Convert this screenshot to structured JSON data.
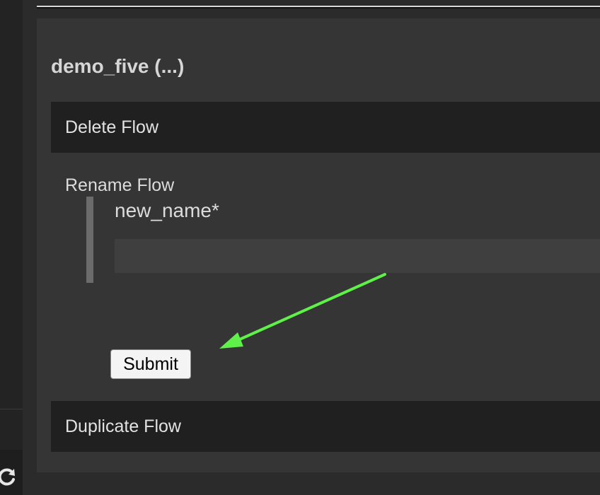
{
  "panel": {
    "title": "demo_five (...)"
  },
  "sections": {
    "delete_label": "Delete Flow",
    "rename_label": "Rename Flow",
    "duplicate_label": "Duplicate Flow"
  },
  "rename_form": {
    "field_label": "new_name*",
    "field_value": "",
    "field_placeholder": "",
    "submit_label": "Submit"
  },
  "colors": {
    "background": "#2b2b2b",
    "panel": "#353535",
    "section_bar": "#202020",
    "annotation_arrow": "#5ff04a"
  },
  "icons": {
    "sidebar_bottom": "refresh-icon"
  }
}
